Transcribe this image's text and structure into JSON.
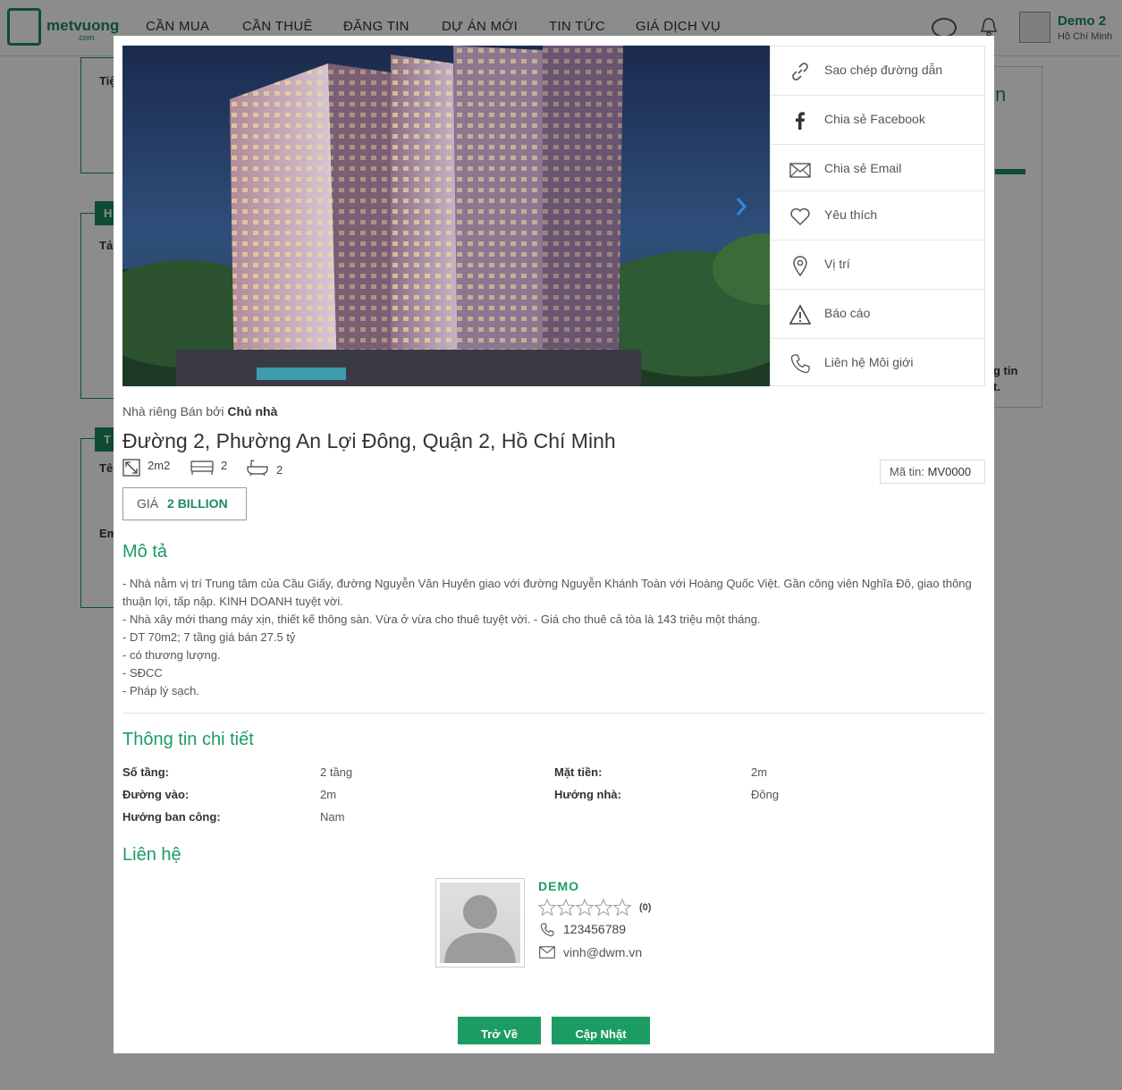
{
  "header": {
    "logo_text": "metvuong",
    "logo_sub": ".com",
    "nav": [
      "CẦN MUA",
      "CẦN THUÊ",
      "ĐĂNG TIN",
      "DỰ ÁN MỚI",
      "TIN TỨC",
      "GIÁ DỊCH VỤ"
    ],
    "user_name": "Demo 2",
    "user_city": "Hồ Chí Minh"
  },
  "background": {
    "tab_1": "H",
    "tab_2": "T",
    "frag_1": "Tiệ",
    "frag_2": "Tả",
    "frag_3": "Tê",
    "frag_4": "Em",
    "right_frag_1": "n",
    "right_frag_2": "g tin",
    "right_frag_3": "t."
  },
  "modal": {
    "share_menu": [
      {
        "icon": "link-icon",
        "label": "Sao chép đường dẫn"
      },
      {
        "icon": "facebook-icon",
        "label": "Chia sẻ Facebook"
      },
      {
        "icon": "email-icon",
        "label": "Chia sẻ Email"
      },
      {
        "icon": "heart-icon",
        "label": "Yêu thích"
      },
      {
        "icon": "location-icon",
        "label": "Vị trí"
      },
      {
        "icon": "warning-icon",
        "label": "Báo cáo"
      },
      {
        "icon": "phone-icon",
        "label": "Liên hệ Môi giới"
      }
    ],
    "type_prefix": "Nhà riêng Bán bởi",
    "type_owner": "Chủ nhà",
    "address": "Đường 2, Phường An Lợi Đông, Quận 2, Hồ Chí Minh",
    "stats": {
      "area": "2m2",
      "bedrooms": "2",
      "bathrooms": "2"
    },
    "code_label": "Mã tin:",
    "code_value": "MV0000",
    "price_label": "GIÁ",
    "price_value": "2 BILLION",
    "description_title": "Mô tả",
    "description_lines": [
      "- Nhà nằm vị trí Trung tâm của Cầu Giấy, đường Nguyễn Văn Huyên giao với đường Nguyễn Khánh Toàn với Hoàng Quốc Việt. Gần công viên Nghĩa Đô, giao thông thuận lợi, tấp nập. KINH DOANH tuyệt vời.",
      "- Nhà xây mới thang máy xịn, thiết kế thông sàn. Vừa ở vừa cho thuê tuyệt vời. - Giá cho thuê cả tòa là 143 triệu một tháng.",
      "- DT 70m2; 7 tầng giá bán 27.5 tỷ",
      "- có thương lượng.",
      "- SĐCC",
      "- Pháp lý sạch."
    ],
    "details_title": "Thông tin chi tiết",
    "details": {
      "floors_label": "Số tầng:",
      "floors_value": "2 tầng",
      "frontage_label": "Mặt tiền:",
      "frontage_value": "2m",
      "road_label": "Đường vào:",
      "road_value": "2m",
      "direction_label": "Hướng nhà:",
      "direction_value": "Đông",
      "balcony_label": "Hướng ban công:",
      "balcony_value": "Nam"
    },
    "contact_title": "Liên hệ",
    "contact": {
      "name": "DEMO",
      "rating_count": "(0)",
      "phone": "123456789",
      "email": "vinh@dwm.vn"
    },
    "back_button": "Trở Về",
    "update_button": "Cập Nhật"
  },
  "colors": {
    "brand": "#1c8a5d",
    "accent": "#1c9c63",
    "overlay": "rgba(0,0,0,0.45)"
  }
}
